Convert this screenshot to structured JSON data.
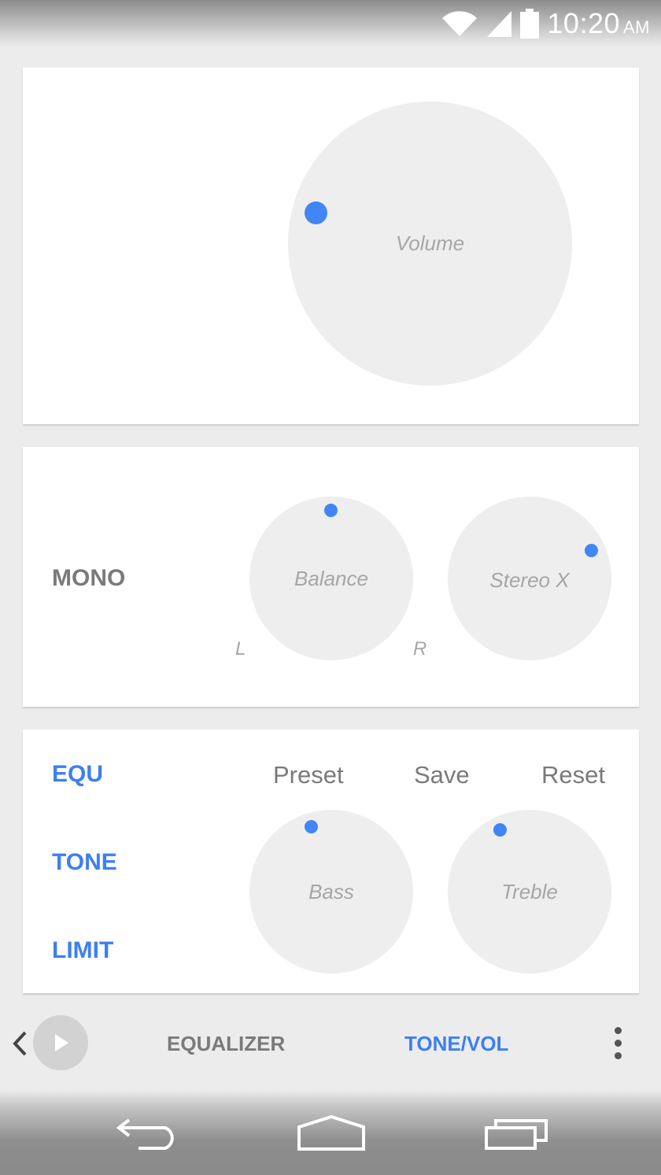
{
  "status_bar": {
    "time": "10:20",
    "ampm": "AM",
    "icons": [
      "wifi-icon",
      "cell-signal-icon",
      "battery-icon"
    ]
  },
  "volume_card": {
    "volume_label": "Volume"
  },
  "balance_card": {
    "mono_label": "MONO",
    "balance_label": "Balance",
    "left_label": "L",
    "right_label": "R",
    "stereo_label": "Stereo X"
  },
  "tone_card": {
    "side_items": [
      "EQU",
      "TONE",
      "LIMIT"
    ],
    "actions": [
      "Preset",
      "Save",
      "Reset"
    ],
    "bass_label": "Bass",
    "treble_label": "Treble"
  },
  "bottom_bar": {
    "tabs": [
      "EQUALIZER",
      "TONE/VOL"
    ],
    "active_tab": "TONE/VOL"
  },
  "colors": {
    "accent": "#4285f4",
    "accent_text": "#3d7ff2",
    "inactive_text": "#7a7a7a",
    "knob": "#eeeeee",
    "background": "#ececec",
    "card": "#ffffff"
  },
  "nav_bar": {
    "icons": [
      "back-icon",
      "home-icon",
      "recent-apps-icon"
    ]
  }
}
